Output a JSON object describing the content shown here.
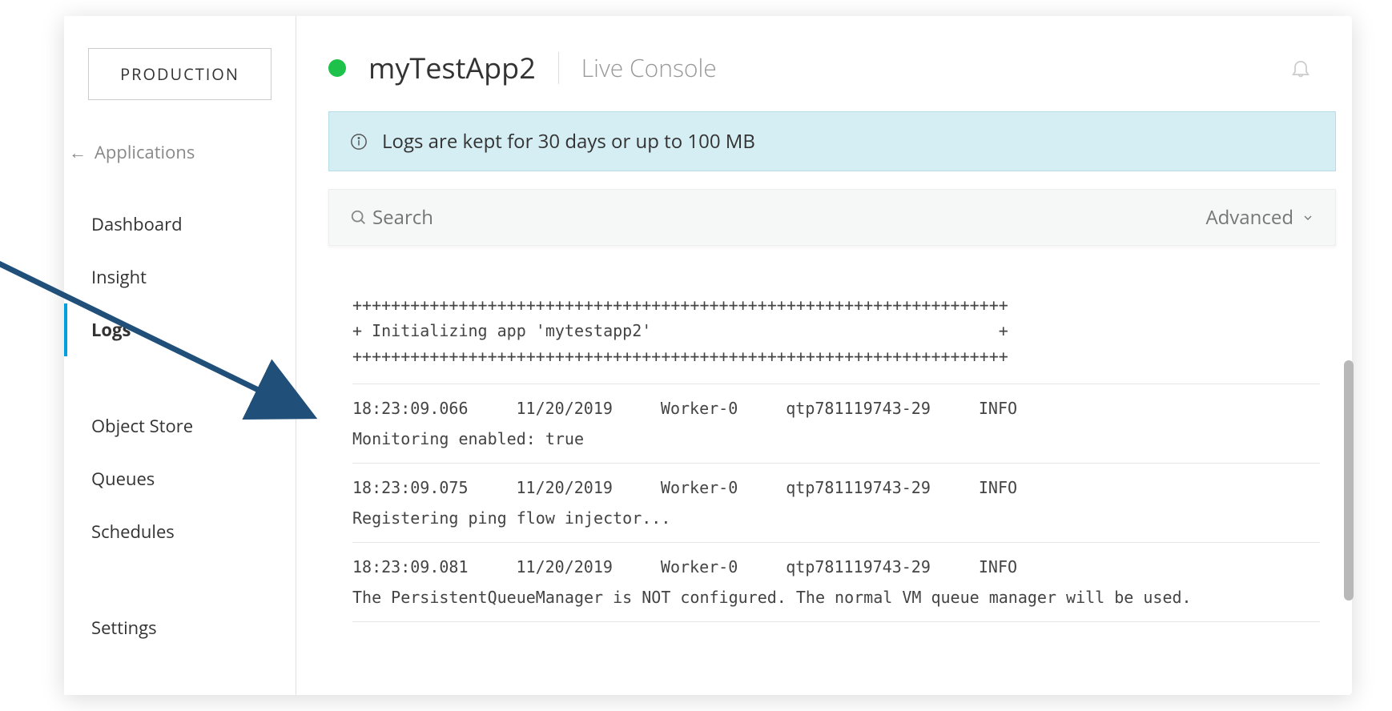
{
  "env_label": "PRODUCTION",
  "back_link": "Applications",
  "sidebar": {
    "items": [
      {
        "label": "Dashboard"
      },
      {
        "label": "Insight"
      },
      {
        "label": "Logs",
        "active": true
      },
      {
        "label": "Object Store"
      },
      {
        "label": "Queues"
      },
      {
        "label": "Schedules"
      },
      {
        "label": "Settings"
      }
    ]
  },
  "header": {
    "app_name": "myTestApp2",
    "subtitle": "Live Console"
  },
  "banner": {
    "text": "Logs are kept for 30 days or up to 100 MB"
  },
  "search": {
    "placeholder": "Search",
    "advanced_label": "Advanced"
  },
  "logs": {
    "init_block": "++++++++++++++++++++++++++++++++++++++++++++++++++++++++++++++++++++\n+ Initializing app 'mytestapp2'                                    +\n++++++++++++++++++++++++++++++++++++++++++++++++++++++++++++++++++++",
    "entries": [
      {
        "time": "18:23:09.066",
        "date": "11/20/2019",
        "worker": "Worker-0",
        "thread": "qtp781119743-29",
        "level": "INFO",
        "message": "Monitoring enabled: true"
      },
      {
        "time": "18:23:09.075",
        "date": "11/20/2019",
        "worker": "Worker-0",
        "thread": "qtp781119743-29",
        "level": "INFO",
        "message": "Registering ping flow injector..."
      },
      {
        "time": "18:23:09.081",
        "date": "11/20/2019",
        "worker": "Worker-0",
        "thread": "qtp781119743-29",
        "level": "INFO",
        "message": "The PersistentQueueManager is NOT configured. The normal VM queue manager will be used."
      }
    ]
  }
}
